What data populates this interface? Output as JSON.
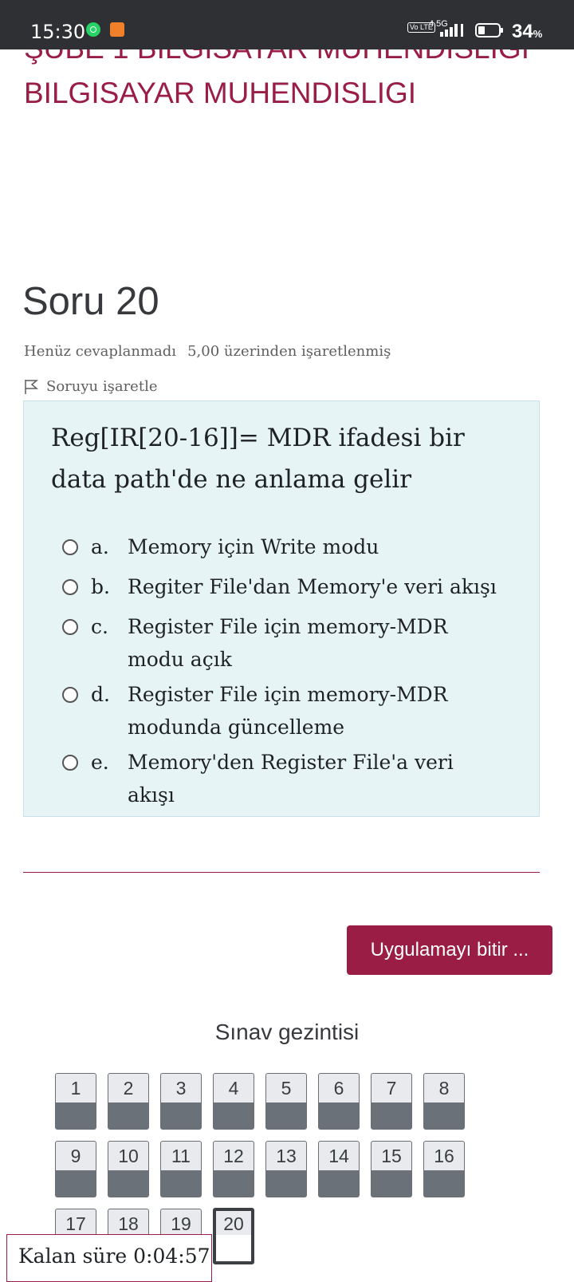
{
  "status_bar": {
    "time": "15:30",
    "network": "4.5G",
    "volte": "Vo LTE",
    "battery": "34",
    "battery_unit": "%"
  },
  "course": {
    "title": "ŞUBE 1 BILGISAYAR MUHENDISLIGI BILGISAYAR MUHENDISLIGI"
  },
  "question": {
    "title": "Soru 20",
    "state": "Henüz cevaplanmadı",
    "grade": "5,00 üzerinden işaretlenmiş",
    "flag_label": "Soruyu işaretle",
    "text": "Reg[IR[20-16]]= MDR ifadesi bir data path'de ne anlama gelir",
    "options": [
      {
        "letter": "a.",
        "text": "Memory için Write modu"
      },
      {
        "letter": "b.",
        "text": "Regiter File'dan Memory'e veri akışı"
      },
      {
        "letter": "c.",
        "text": "Register File için memory-MDR modu açık"
      },
      {
        "letter": "d.",
        "text": "Register File için memory-MDR modunda güncelleme"
      },
      {
        "letter": "e.",
        "text": "Memory'den Register File'a veri akışı"
      }
    ]
  },
  "finish_button": "Uygulamayı bitir ...",
  "navigation": {
    "title": "Sınav gezintisi",
    "buttons": [
      "1",
      "2",
      "3",
      "4",
      "5",
      "6",
      "7",
      "8",
      "9",
      "10",
      "11",
      "12",
      "13",
      "14",
      "15",
      "16",
      "17",
      "18",
      "19",
      "20"
    ],
    "current": "20"
  },
  "timer": "Kalan süre 0:04:57",
  "colors": {
    "brand": "#9a1d45",
    "question_bg": "#e7f4f6",
    "status_bar": "#2f3033"
  }
}
